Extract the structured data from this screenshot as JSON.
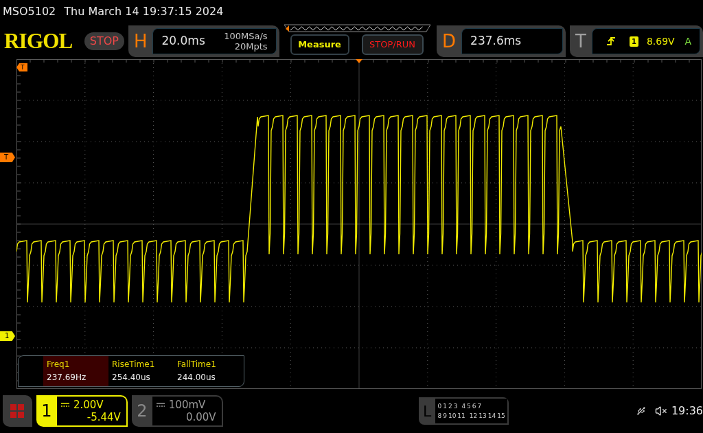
{
  "status_line": {
    "model": "MSO5102",
    "datetime": "Thu March 14 19:37:15 2024"
  },
  "logo": "RIGOL",
  "run_state": "STOP",
  "horizontal": {
    "letter": "H",
    "timebase": "20.0ms",
    "sample_rate": "100MSa/s",
    "memory_depth": "20Mpts"
  },
  "measure_button": "Measure",
  "stop_run_button": "STOP/RUN",
  "delay": {
    "letter": "D",
    "value": "237.6ms"
  },
  "trigger": {
    "letter": "T",
    "source": "1",
    "level": "8.69V",
    "mode": "A"
  },
  "markers": {
    "time_marker": "T",
    "trigger_level_marker": "T",
    "channel_marker": "1"
  },
  "measurements": [
    {
      "name": "Freq1",
      "value": "237.69Hz",
      "selected": true
    },
    {
      "name": "RiseTime1",
      "value": "254.40us",
      "selected": false
    },
    {
      "name": "FallTime1",
      "value": "244.00us",
      "selected": false
    }
  ],
  "channels": [
    {
      "number": "1",
      "scale": "2.00V",
      "offset": "-5.44V",
      "selected": true
    },
    {
      "number": "2",
      "scale": "100mV",
      "offset": "0.00V",
      "selected": false
    }
  ],
  "logic": {
    "letter": "L",
    "row_1": [
      "0",
      "1",
      "2",
      "3",
      "4",
      "5",
      "6",
      "7"
    ],
    "row_2": [
      "8",
      "9",
      "10",
      "11",
      "12",
      "13",
      "14",
      "15"
    ]
  },
  "clock": "19:36"
}
